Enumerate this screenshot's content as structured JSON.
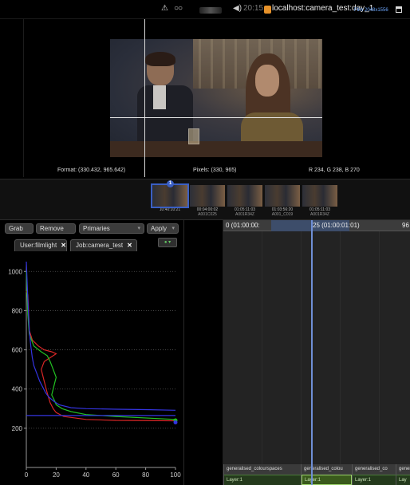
{
  "topbar": {
    "clock": "20:15",
    "location": "localhost:camera_test:day_1",
    "film_info": "Film 2048x1556",
    "icons": [
      "warning-icon",
      "stereo-glasses-icon",
      "speaker-icon",
      "database-icon",
      "window-icon"
    ]
  },
  "viewer": {
    "format_readout": "Format: (330.432, 965.642)",
    "pixels_readout": "Pixels: (330, 965)",
    "color_readout": "R 234, G 238, B 270"
  },
  "filmstrip": {
    "thumbs": [
      {
        "tc": "10:40:10:21",
        "clip": "",
        "badge": "1",
        "selected": true
      },
      {
        "tc": "00:04:00:02",
        "clip": "A001C025",
        "badge": "",
        "selected": false
      },
      {
        "tc": "01:05:11:03",
        "clip": "A001R34Z",
        "badge": "",
        "selected": false
      },
      {
        "tc": "01:03:56:20",
        "clip": "A001_C019",
        "badge": "",
        "selected": false
      },
      {
        "tc": "01:05:11:03",
        "clip": "A001R34Z",
        "badge": "",
        "selected": false
      }
    ]
  },
  "toolbar": {
    "grab_label": "Grab",
    "remove_label": "Remove",
    "primaries_label": "Primaries",
    "apply_label": "Apply"
  },
  "tabs": [
    {
      "label": "User:filmlight",
      "close": "✕"
    },
    {
      "label": "Job:camera_test",
      "close": "✕"
    }
  ],
  "chart_data": {
    "type": "line",
    "title": "",
    "xlabel": "",
    "ylabel": "",
    "xlim": [
      0,
      100
    ],
    "ylim": [
      0,
      1050
    ],
    "x_ticks": [
      0,
      20,
      40,
      60,
      80,
      100
    ],
    "y_ticks": [
      200,
      400,
      600,
      800,
      1000
    ],
    "grid": "dotted-horizontal",
    "series": [
      {
        "color": "#d92626",
        "x": [
          0,
          1,
          1.5,
          2,
          4,
          8,
          12,
          17,
          20,
          16,
          12,
          10,
          12,
          14,
          16,
          18,
          20,
          25,
          40,
          60,
          100
        ],
        "y": [
          900,
          880,
          800,
          700,
          650,
          620,
          600,
          590,
          580,
          560,
          540,
          500,
          440,
          380,
          330,
          300,
          280,
          260,
          245,
          240,
          238
        ]
      },
      {
        "color": "#22c022",
        "x": [
          0,
          0.5,
          1,
          2,
          5,
          10,
          14,
          16,
          18,
          20,
          19,
          18,
          17,
          19,
          20,
          24,
          30,
          40,
          60,
          100
        ],
        "y": [
          1000,
          900,
          780,
          680,
          620,
          590,
          570,
          540,
          500,
          460,
          430,
          400,
          370,
          340,
          320,
          300,
          285,
          270,
          260,
          245
        ]
      },
      {
        "color": "#3434e0",
        "x": [
          0,
          1,
          2,
          3,
          4,
          5,
          7,
          9,
          11,
          13,
          15,
          18,
          22,
          30,
          40,
          60,
          80,
          100
        ],
        "y": [
          1050,
          860,
          700,
          620,
          560,
          520,
          480,
          440,
          410,
          380,
          360,
          340,
          320,
          305,
          300,
          297,
          295,
          292
        ]
      },
      {
        "color": "#3434e0",
        "x": [
          0,
          100
        ],
        "y": [
          265,
          265
        ]
      }
    ],
    "points": [
      {
        "x": 100,
        "y": 240,
        "color": "#22c022"
      },
      {
        "x": 100,
        "y": 230,
        "color": "#3434e0"
      }
    ]
  },
  "timeline": {
    "start_label": "0 (01:00:00:",
    "current_label": "25 (01:00:01:01)",
    "end_label": "96",
    "clips": [
      {
        "name": "generalised_colourspaces",
        "layer": "Layer:1",
        "selected": false
      },
      {
        "name": "generalised_colou",
        "layer": "Layer:1",
        "selected": true
      },
      {
        "name": "generalised_co",
        "layer": "Layer:1",
        "selected": false
      },
      {
        "name": "genera",
        "layer": "Lay",
        "selected": false
      }
    ]
  }
}
